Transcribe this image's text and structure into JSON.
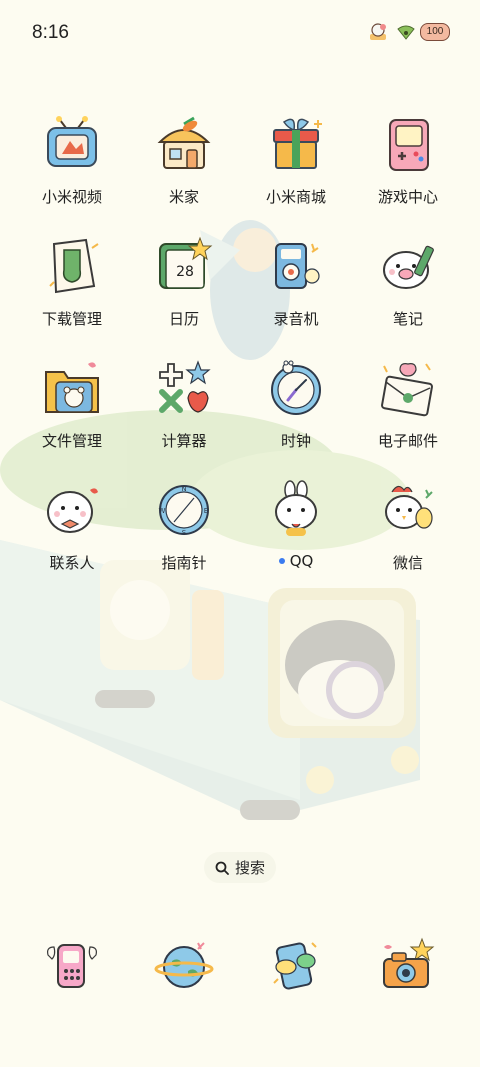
{
  "status_bar": {
    "time": "8:16",
    "battery": "100",
    "icons": [
      "ice-cream-icon",
      "wifi-icon",
      "battery-icon"
    ]
  },
  "apps": [
    {
      "label": "小米视频",
      "icon": "tv-icon"
    },
    {
      "label": "米家",
      "icon": "house-icon"
    },
    {
      "label": "小米商城",
      "icon": "gift-box-icon"
    },
    {
      "label": "游戏中心",
      "icon": "game-console-icon"
    },
    {
      "label": "下载管理",
      "icon": "sock-icon"
    },
    {
      "label": "日历",
      "icon": "calendar-icon",
      "day": "28"
    },
    {
      "label": "录音机",
      "icon": "recorder-icon"
    },
    {
      "label": "笔记",
      "icon": "pig-pen-icon"
    },
    {
      "label": "文件管理",
      "icon": "folder-bear-icon"
    },
    {
      "label": "计算器",
      "icon": "calculator-icon"
    },
    {
      "label": "时钟",
      "icon": "clock-icon"
    },
    {
      "label": "电子邮件",
      "icon": "envelope-icon"
    },
    {
      "label": "联系人",
      "icon": "contacts-bunny-icon"
    },
    {
      "label": "指南针",
      "icon": "compass-icon"
    },
    {
      "label": "QQ",
      "icon": "qq-bunny-icon",
      "has_notification_dot": true
    },
    {
      "label": "微信",
      "icon": "wechat-chick-icon"
    }
  ],
  "search": {
    "label": "搜索",
    "icon": "search-icon"
  },
  "dock": [
    {
      "icon": "phone-icon"
    },
    {
      "icon": "browser-globe-icon"
    },
    {
      "icon": "messages-icon"
    },
    {
      "icon": "camera-icon"
    }
  ],
  "colors": {
    "background": "#fdfcf1",
    "notification_dot": "#3a7bf0"
  }
}
